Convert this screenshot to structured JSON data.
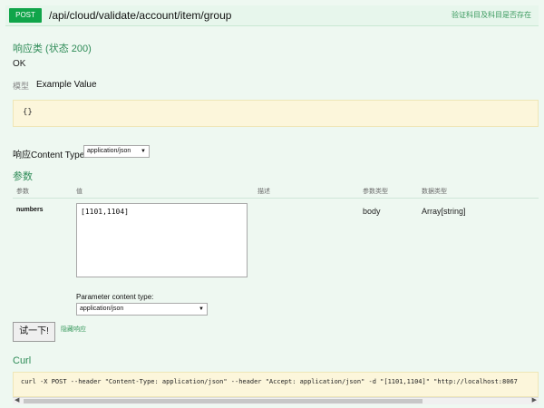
{
  "operation": {
    "method": "POST",
    "path": "/api/cloud/validate/account/item/group",
    "summary": "验证科目及科目是否存在",
    "method_color": "#10a54a"
  },
  "response": {
    "title": "响应类 (状态 200)",
    "status": "OK",
    "tabs": {
      "model": "模型",
      "example": "Example Value"
    },
    "sample_value": "{}",
    "content_type_label": "响应Content Type",
    "content_type_selected": "application/json"
  },
  "parameters": {
    "title": "参数",
    "headers": {
      "name": "参数",
      "value": "值",
      "description": "描述",
      "param_type": "参数类型",
      "data_type": "数据类型"
    },
    "rows": [
      {
        "name": "numbers",
        "value": "[1101,1104]",
        "description": "",
        "param_type": "body",
        "data_type": "Array[string]"
      }
    ],
    "pct_label": "Parameter content type:",
    "pct_selected": "application/json"
  },
  "actions": {
    "try_label": "试一下!",
    "hide_response": "隐藏响应"
  },
  "curl": {
    "title": "Curl",
    "command": "curl -X POST --header \"Content-Type: application/json\" --header \"Accept: application/json\" -d \"[1101,1104]\" \"http://localhost:8067"
  },
  "colors": {
    "accent_green": "#2e8b57",
    "panel_bg": "#eef8f1",
    "sample_bg": "#fcf6db"
  }
}
